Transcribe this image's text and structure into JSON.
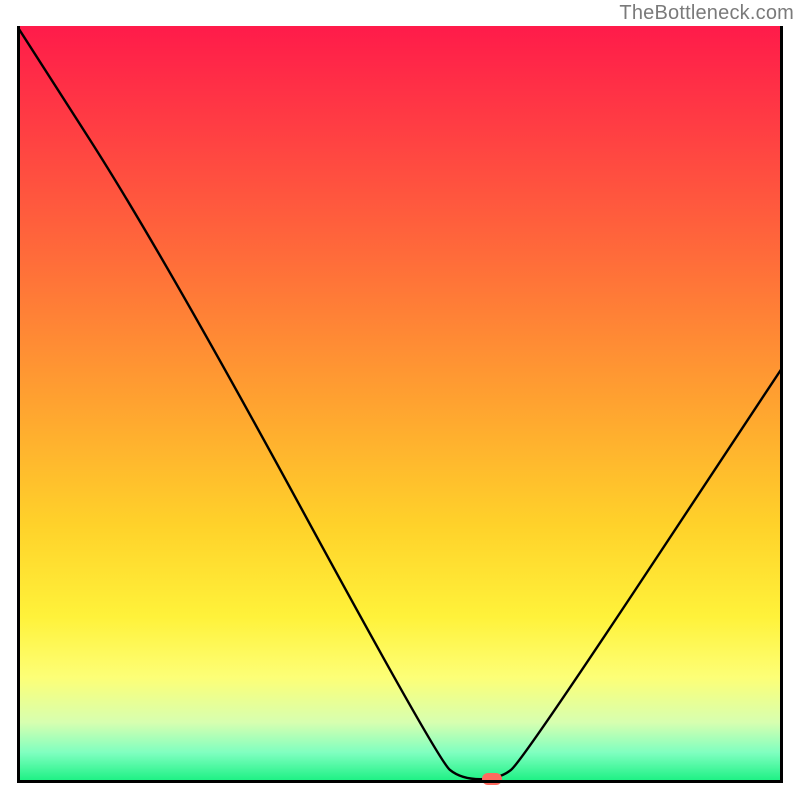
{
  "attribution": "TheBottleneck.com",
  "colors": {
    "gradient_top": "#ff1b4a",
    "gradient_bottom": "#15f07f",
    "curve": "#000000",
    "marker": "#ff6a5e",
    "border": "#000000"
  },
  "chart_data": {
    "type": "line",
    "title": "",
    "xlabel": "",
    "ylabel": "",
    "xlim": [
      0,
      100
    ],
    "ylim": [
      0,
      100
    ],
    "grid": false,
    "legend": false,
    "curve": [
      {
        "x": 0,
        "y": 100
      },
      {
        "x": 19,
        "y": 70
      },
      {
        "x": 55,
        "y": 3
      },
      {
        "x": 58,
        "y": 0.5
      },
      {
        "x": 63,
        "y": 0.5
      },
      {
        "x": 66,
        "y": 3
      },
      {
        "x": 100,
        "y": 55
      }
    ],
    "marker": {
      "x": 62,
      "y": 0.5
    },
    "annotations": []
  }
}
